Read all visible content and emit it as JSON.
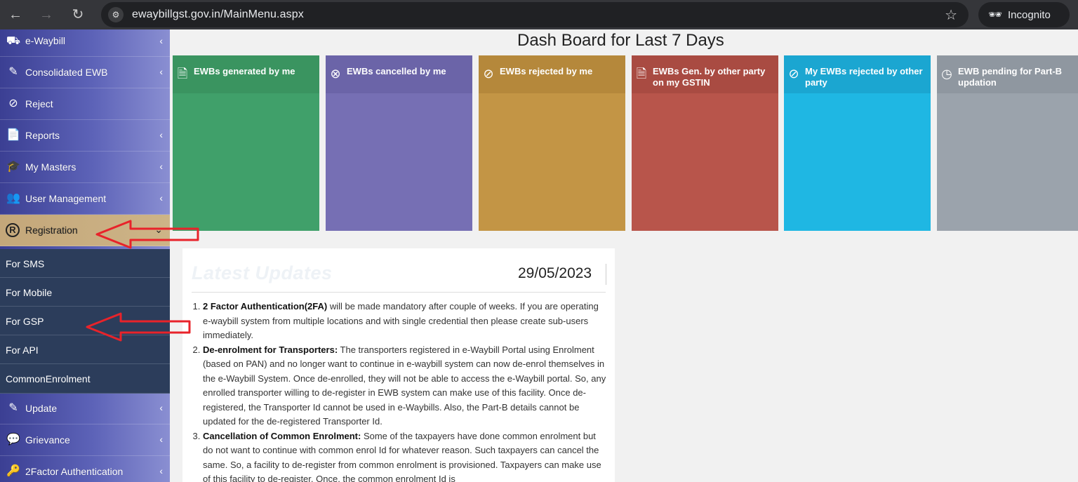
{
  "browser": {
    "url": "ewaybillgst.gov.in/MainMenu.aspx",
    "profile_label": "Incognito",
    "icons": [
      "back-arrow-icon",
      "forward-arrow-icon",
      "reload-icon",
      "site-info-icon",
      "star-icon",
      "incognito-icon"
    ]
  },
  "sidebar": {
    "items": [
      {
        "label": "e-Waybill",
        "icon": "truck-icon"
      },
      {
        "label": "Consolidated EWB",
        "icon": "edit-icon"
      },
      {
        "label": "Reject",
        "icon": "ban-icon"
      },
      {
        "label": "Reports",
        "icon": "file-icon"
      },
      {
        "label": "My Masters",
        "icon": "graduation-cap-icon"
      },
      {
        "label": "User Management",
        "icon": "users-icon"
      },
      {
        "label": "Registration",
        "icon": "registered-icon"
      }
    ],
    "sub_items": [
      {
        "label": "For SMS"
      },
      {
        "label": "For Mobile"
      },
      {
        "label": "For GSP"
      },
      {
        "label": "For API"
      },
      {
        "label": "CommonEnrolment"
      }
    ],
    "items_after": [
      {
        "label": "Update",
        "icon": "edit-icon"
      },
      {
        "label": "Grievance",
        "icon": "comments-icon"
      },
      {
        "label": "2Factor Authentication",
        "icon": "key-icon"
      }
    ],
    "active_item": "Registration",
    "active_color": "#c4a77a",
    "sub_bg_color": "#2c3d5b"
  },
  "dashboard": {
    "title": "Dash Board for Last 7 Days",
    "tiles": [
      {
        "label": "EWBs generated by me",
        "icon": "file-icon",
        "color": "#40a06a",
        "head_color": "#3a9460"
      },
      {
        "label": "EWBs cancelled by me",
        "icon": "cancel-circle-icon",
        "color": "#766fb4",
        "head_color": "#6b64a8"
      },
      {
        "label": "EWBs rejected by me",
        "icon": "ban-icon",
        "color": "#c39545",
        "head_color": "#b5883b"
      },
      {
        "label": "EWBs Gen. by other party on my GSTIN",
        "icon": "file-icon",
        "color": "#b8554b",
        "head_color": "#a94b42"
      },
      {
        "label": "My EWBs rejected by other party",
        "icon": "ban-icon",
        "color": "#1fb7e3",
        "head_color": "#1ba6d1"
      },
      {
        "label": "EWB pending for Part-B updation",
        "icon": "clock-icon",
        "color": "#9ba3ac",
        "head_color": "#8f97a0"
      }
    ]
  },
  "updates": {
    "title": "Latest Updates",
    "date": "29/05/2023",
    "items": [
      {
        "heading": "2 Factor Authentication(2FA)",
        "text": " will be made mandatory after couple of weeks. If you are operating e-waybill system from multiple locations and with single credential then please create sub-users immediately."
      },
      {
        "heading": "De-enrolment for Transporters:",
        "text": " The transporters registered in e-Waybill Portal using Enrolment (based on PAN) and no longer want to continue in e-waybill system can now de-enrol themselves in the e-Waybill System. Once de-enrolled, they will not be able to access the e-Waybill portal. So, any enrolled transporter willing to de-register in EWB system can make use of this facility. Once de-registered, the Transporter Id cannot be used in e-Waybills. Also, the Part-B details cannot be updated for the de-registered Transporter Id."
      },
      {
        "heading": "Cancellation of Common Enrolment:",
        "text": " Some of the taxpayers have done common enrolment but do not want to continue with common enrol Id for whatever reason. Such taxpayers can cancel the same. So, a facility to de-register from common enrolment is provisioned. Taxpayers can make use of this facility to de-register. Once, the common enrolment Id is"
      }
    ]
  },
  "annotation_color": "#e8232a"
}
